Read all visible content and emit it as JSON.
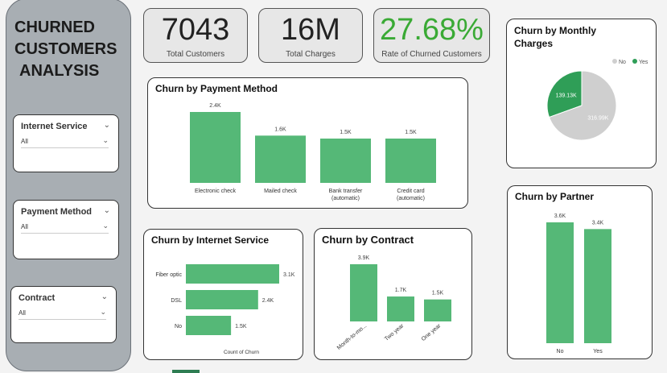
{
  "dashboard": {
    "title_lines": [
      "CHURNED",
      "CUSTOMERS",
      "ANALYSIS"
    ]
  },
  "slicers": [
    {
      "label": "Internet Service",
      "value": "All"
    },
    {
      "label": "Payment Method",
      "value": "All"
    },
    {
      "label": "Contract",
      "value": "All"
    }
  ],
  "kpis": [
    {
      "value": "7043",
      "label": "Total Customers"
    },
    {
      "value": "16M",
      "label": "Total Charges"
    },
    {
      "value": "27.68%",
      "label": "Rate of Churned Customers"
    }
  ],
  "colors": {
    "green": "#55b877",
    "green_dark": "#2f9e57",
    "grey": "#cfcfcf",
    "kpi_green": "#3aaa35"
  },
  "chart_data": [
    {
      "id": "payment",
      "type": "bar",
      "title": "Churn by Payment Method",
      "categories": [
        "Electronic check",
        "Mailed check",
        "Bank transfer (automatic)",
        "Credit card (automatic)"
      ],
      "category_lines": [
        [
          "Electronic check"
        ],
        [
          "Mailed check"
        ],
        [
          "Bank transfer",
          "(automatic)"
        ],
        [
          "Credit card",
          "(automatic)"
        ]
      ],
      "values": [
        2400,
        1600,
        1500,
        1500
      ],
      "labels": [
        "2.4K",
        "1.6K",
        "1.5K",
        "1.5K"
      ],
      "ylim": [
        0,
        2400
      ]
    },
    {
      "id": "internet",
      "type": "bar",
      "orientation": "horizontal",
      "title": "Churn by Internet Service",
      "categories": [
        "Fiber optic",
        "DSL",
        "No"
      ],
      "values": [
        3100,
        2400,
        1500
      ],
      "labels": [
        "3.1K",
        "2.4K",
        "1.5K"
      ],
      "xlabel": "Count of Churn",
      "xlim": [
        0,
        3100
      ]
    },
    {
      "id": "contract",
      "type": "bar",
      "title": "Churn by Contract",
      "categories": [
        "Month-to-mo...",
        "Two year",
        "One year"
      ],
      "values": [
        3900,
        1700,
        1500
      ],
      "labels": [
        "3.9K",
        "1.7K",
        "1.5K"
      ],
      "ylim": [
        0,
        3900
      ]
    },
    {
      "id": "monthly",
      "type": "pie",
      "title": "Churn by Monthly Charges",
      "legend": [
        "No",
        "Yes"
      ],
      "series": [
        {
          "name": "No",
          "value": 316990,
          "label": "316.99K"
        },
        {
          "name": "Yes",
          "value": 139130,
          "label": "139.13K"
        }
      ]
    },
    {
      "id": "partner",
      "type": "bar",
      "title": "Churn by Partner",
      "categories": [
        "No",
        "Yes"
      ],
      "values": [
        3600,
        3400
      ],
      "labels": [
        "3.6K",
        "3.4K"
      ],
      "ylim": [
        0,
        3600
      ]
    }
  ]
}
